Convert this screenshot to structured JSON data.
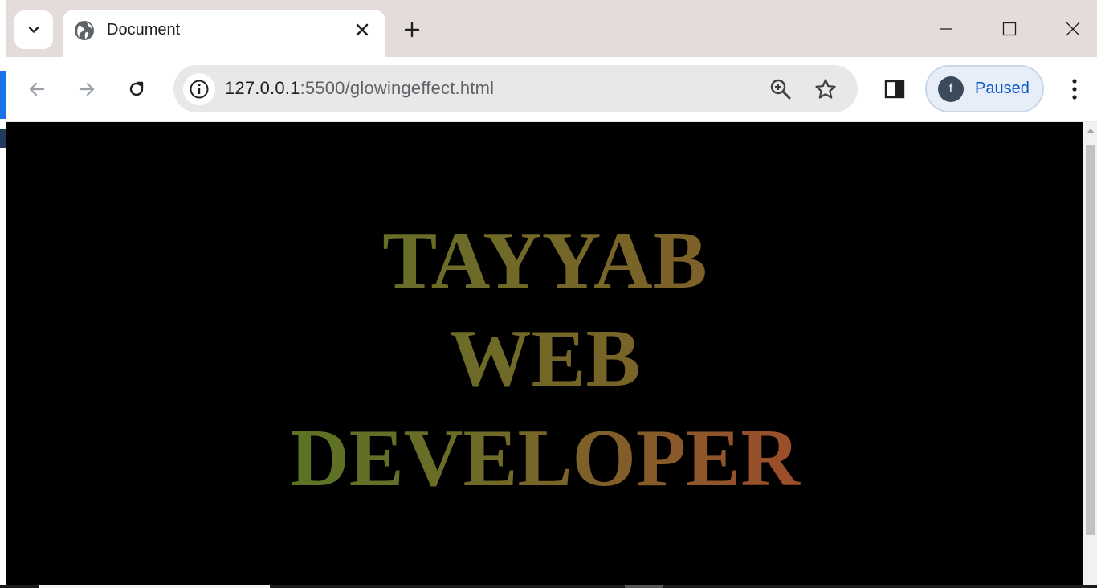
{
  "browser": {
    "tab": {
      "title": "Document",
      "favicon": "globe-icon"
    },
    "address_bar": {
      "host": "127.0.0.1",
      "path": ":5500/glowingeffect.html"
    },
    "profile": {
      "initial": "f",
      "label": "Paused"
    },
    "icons": {
      "tab_search": "chevron-down-icon",
      "tab_close": "close-icon",
      "new_tab": "plus-icon",
      "minimize": "minimize-icon",
      "maximize": "maximize-icon",
      "close_window": "close-icon",
      "back": "arrow-left-icon",
      "forward": "arrow-right-icon",
      "reload": "reload-icon",
      "site_info": "info-icon",
      "zoom": "zoom-icon",
      "bookmark": "star-icon",
      "side_panel": "side-panel-icon",
      "menu": "kebab-menu-icon"
    }
  },
  "page": {
    "background": "#000000",
    "lines": [
      "TAYYAB",
      "WEB",
      "DEVELOPER"
    ],
    "colors": {
      "green": "#4b7a21",
      "olive": "#6f6a28",
      "brown": "#9a4e2a",
      "red": "#b03a2a"
    }
  }
}
